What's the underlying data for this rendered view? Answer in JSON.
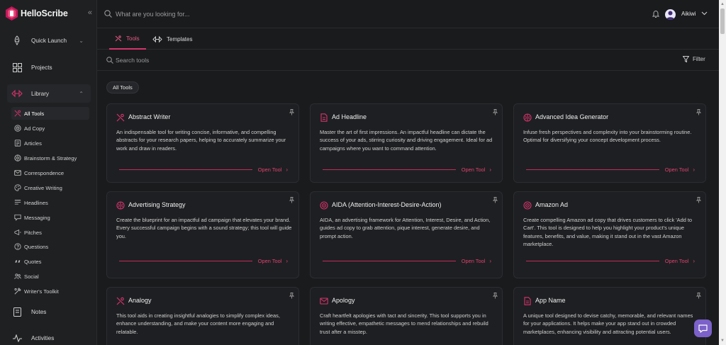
{
  "app": {
    "name": "HelloScribe",
    "accent": "#d6336c"
  },
  "topbar": {
    "search_placeholder": "What are you looking for...",
    "username": "Aikiwi"
  },
  "sidebar": {
    "collapse_icon": "double-chevron-left-icon",
    "quick_launch": "Quick Launch",
    "projects": "Projects",
    "library": "Library",
    "notes": "Notes",
    "activities": "Activities",
    "library_items": [
      {
        "label": "All Tools",
        "icon": "tools-icon",
        "active": true
      },
      {
        "label": "Ad Copy",
        "icon": "target-icon"
      },
      {
        "label": "Articles",
        "icon": "article-icon"
      },
      {
        "label": "Brainstorm & Strategy",
        "icon": "brain-icon"
      },
      {
        "label": "Correspondence",
        "icon": "mail-icon"
      },
      {
        "label": "Creative Writing",
        "icon": "palette-icon"
      },
      {
        "label": "Headlines",
        "icon": "headline-icon"
      },
      {
        "label": "Messaging",
        "icon": "message-icon"
      },
      {
        "label": "Pitches",
        "icon": "pitch-icon"
      },
      {
        "label": "Questions",
        "icon": "question-icon"
      },
      {
        "label": "Quotes",
        "icon": "quote-icon"
      },
      {
        "label": "Social",
        "icon": "social-icon"
      },
      {
        "label": "Writer's Toolkit",
        "icon": "toolkit-icon"
      }
    ]
  },
  "tabs": {
    "tools": "Tools",
    "templates": "Templates"
  },
  "tools_search": {
    "placeholder": "Search tools",
    "filter_label": "Filter"
  },
  "chip": {
    "label": "All Tools"
  },
  "open_label": "Open Tool",
  "cards": [
    {
      "title": "Abstract Writer",
      "icon": "tools-icon",
      "desc": "An indispensable tool for writing concise, informative, and compelling abstracts for your research papers, helping to accurately summarize your work and draw in readers."
    },
    {
      "title": "Ad Headline",
      "icon": "document-icon",
      "desc": "Master the art of first impressions. An impactful headline can dictate the success of your ads, stirring curiosity and driving engagement. Ideal for ad campaigns where you want to command attention."
    },
    {
      "title": "Advanced Idea Generator",
      "icon": "brain-icon",
      "desc": "Infuse fresh perspectives and complexity into your brainstorming routine. Optimal for diversifying your concept development process."
    },
    {
      "title": "Advertising Strategy",
      "icon": "brain-icon",
      "desc": "Create the blueprint for an impactful ad campaign that elevates your brand. Every successful campaign begins with a sound strategy; this tool will guide you."
    },
    {
      "title": "AIDA (Attention-Interest-Desire-Action)",
      "icon": "target-icon",
      "desc": "AIDA, an advertising framework for Attention, Interest, Desire, and Action, guides ad copy to grab attention, pique interest, generate desire, and prompt action."
    },
    {
      "title": "Amazon Ad",
      "icon": "target-icon",
      "desc": "Create compelling Amazon ad copy that drives customers to click 'Add to Cart'. This tool is designed to help you highlight your product's unique features, benefits, and value, making it stand out in the vast Amazon marketplace."
    },
    {
      "title": "Analogy",
      "icon": "tools-icon",
      "desc": "This tool aids in creating insightful analogies to simplify complex ideas, enhance understanding, and make your content more engaging and relatable."
    },
    {
      "title": "Apology",
      "icon": "mail-icon",
      "desc": "Craft heartfelt apologies with tact and sincerity. This tool supports you in writing effective, empathetic messages to mend relationships and rebuild trust after a misstep."
    },
    {
      "title": "App Name",
      "icon": "document-icon",
      "desc": "A unique tool designed to devise catchy, memorable, and relevant names for your applications. It helps make your app stand out in crowded marketplaces, enhancing visibility and attracting potential users."
    }
  ]
}
